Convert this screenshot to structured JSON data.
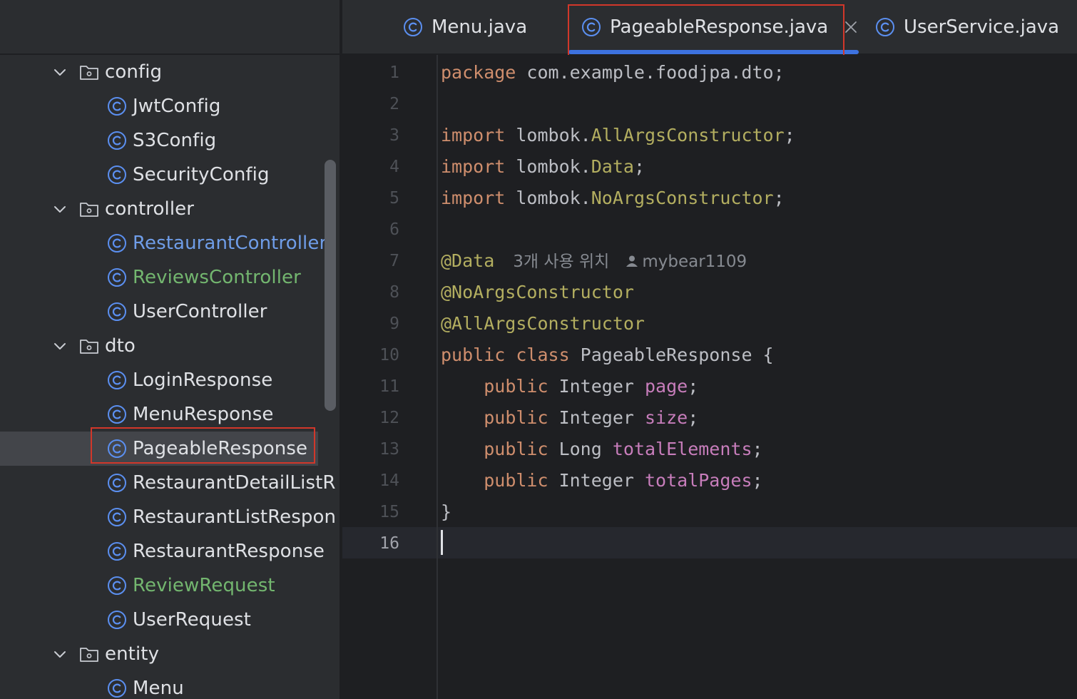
{
  "sidebar": {
    "items": [
      {
        "type": "folder",
        "label": "config",
        "depth": 0
      },
      {
        "type": "class",
        "label": "JwtConfig",
        "depth": 1,
        "tone": "default"
      },
      {
        "type": "class",
        "label": "S3Config",
        "depth": 1,
        "tone": "default"
      },
      {
        "type": "class",
        "label": "SecurityConfig",
        "depth": 1,
        "tone": "default"
      },
      {
        "type": "folder",
        "label": "controller",
        "depth": 0
      },
      {
        "type": "class",
        "label": "RestaurantController",
        "depth": 1,
        "tone": "blue"
      },
      {
        "type": "class",
        "label": "ReviewsController",
        "depth": 1,
        "tone": "green"
      },
      {
        "type": "class",
        "label": "UserController",
        "depth": 1,
        "tone": "default"
      },
      {
        "type": "folder",
        "label": "dto",
        "depth": 0
      },
      {
        "type": "class",
        "label": "LoginResponse",
        "depth": 1,
        "tone": "default"
      },
      {
        "type": "class",
        "label": "MenuResponse",
        "depth": 1,
        "tone": "default"
      },
      {
        "type": "class",
        "label": "PageableResponse",
        "depth": 1,
        "tone": "default",
        "selected": true
      },
      {
        "type": "class",
        "label": "RestaurantDetailListR",
        "depth": 1,
        "tone": "default"
      },
      {
        "type": "class",
        "label": "RestaurantListRespon",
        "depth": 1,
        "tone": "default"
      },
      {
        "type": "class",
        "label": "RestaurantResponse",
        "depth": 1,
        "tone": "default"
      },
      {
        "type": "class",
        "label": "ReviewRequest",
        "depth": 1,
        "tone": "green"
      },
      {
        "type": "class",
        "label": "UserRequest",
        "depth": 1,
        "tone": "default"
      },
      {
        "type": "folder",
        "label": "entity",
        "depth": 0
      },
      {
        "type": "class",
        "label": "Menu",
        "depth": 1,
        "tone": "default"
      }
    ]
  },
  "tabs": [
    {
      "label": "Menu.java",
      "active": false
    },
    {
      "label": "PageableResponse.java",
      "active": true
    },
    {
      "label": "UserService.java",
      "active": false
    }
  ],
  "editor": {
    "current_line": 16,
    "lines": [
      {
        "n": "1",
        "tokens": [
          [
            "kw",
            "package"
          ],
          [
            "plain",
            " com.example.foodjpa.dto;"
          ]
        ]
      },
      {
        "n": "2",
        "tokens": []
      },
      {
        "n": "3",
        "tokens": [
          [
            "kw",
            "import"
          ],
          [
            "plain",
            " lombok."
          ],
          [
            "ann",
            "AllArgsConstructor"
          ],
          [
            "plain",
            ";"
          ]
        ]
      },
      {
        "n": "4",
        "tokens": [
          [
            "kw",
            "import"
          ],
          [
            "plain",
            " lombok."
          ],
          [
            "ann",
            "Data"
          ],
          [
            "plain",
            ";"
          ]
        ]
      },
      {
        "n": "5",
        "tokens": [
          [
            "kw",
            "import"
          ],
          [
            "plain",
            " lombok."
          ],
          [
            "ann",
            "NoArgsConstructor"
          ],
          [
            "plain",
            ";"
          ]
        ]
      },
      {
        "n": "6",
        "tokens": []
      },
      {
        "n": "7",
        "tokens": [
          [
            "ann",
            "@Data"
          ]
        ],
        "hint": {
          "usages": "3개 사용 위치",
          "author": "mybear1109"
        }
      },
      {
        "n": "8",
        "tokens": [
          [
            "ann",
            "@NoArgsConstructor"
          ]
        ]
      },
      {
        "n": "9",
        "tokens": [
          [
            "ann",
            "@AllArgsConstructor"
          ]
        ]
      },
      {
        "n": "10",
        "tokens": [
          [
            "kw",
            "public class"
          ],
          [
            "plain",
            " PageableResponse {"
          ]
        ]
      },
      {
        "n": "11",
        "tokens": [
          [
            "plain",
            "    "
          ],
          [
            "kw",
            "public"
          ],
          [
            "plain",
            " Integer "
          ],
          [
            "fld",
            "page"
          ],
          [
            "plain",
            ";"
          ]
        ]
      },
      {
        "n": "12",
        "tokens": [
          [
            "plain",
            "    "
          ],
          [
            "kw",
            "public"
          ],
          [
            "plain",
            " Integer "
          ],
          [
            "fld",
            "size"
          ],
          [
            "plain",
            ";"
          ]
        ]
      },
      {
        "n": "13",
        "tokens": [
          [
            "plain",
            "    "
          ],
          [
            "kw",
            "public"
          ],
          [
            "plain",
            " Long "
          ],
          [
            "fld",
            "totalElements"
          ],
          [
            "plain",
            ";"
          ]
        ]
      },
      {
        "n": "14",
        "tokens": [
          [
            "plain",
            "    "
          ],
          [
            "kw",
            "public"
          ],
          [
            "plain",
            " Integer "
          ],
          [
            "fld",
            "totalPages"
          ],
          [
            "plain",
            ";"
          ]
        ]
      },
      {
        "n": "15",
        "tokens": [
          [
            "plain",
            "}"
          ]
        ]
      },
      {
        "n": "16",
        "tokens": []
      }
    ]
  },
  "colors": {
    "keyword": "#cf8e6d",
    "annotation": "#b3ae60",
    "field": "#c77dbb",
    "accent": "#3d72e0",
    "highlight_box": "#d2372a"
  },
  "icons": {
    "chevron": "chevron-down-icon",
    "folder": "folder-icon",
    "class": "class-icon",
    "close": "close-icon",
    "user": "user-icon"
  }
}
